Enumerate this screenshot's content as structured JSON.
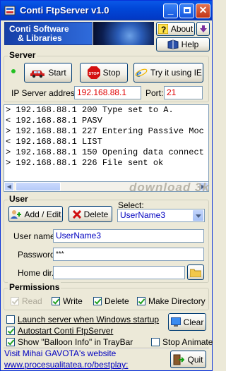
{
  "window": {
    "title": "Conti FtpServer v1.0"
  },
  "banner": {
    "line1": "Conti Software",
    "line2": "& Libraries"
  },
  "header_buttons": {
    "about": "About",
    "help": "Help"
  },
  "server": {
    "group_label": "Server",
    "start": "Start",
    "stop": "Stop",
    "try_ie": "Try it using IE",
    "ip_label": "IP Server address:",
    "ip_value": "192.168.88.1",
    "port_label": "Port:",
    "port_value": "21",
    "status_color": "#22C022"
  },
  "log": {
    "lines": [
      "> 192.168.88.1 200 Type set to A.",
      "< 192.168.88.1 PASV",
      "> 192.168.88.1 227 Entering Passive Moc",
      "< 192.168.88.1 LIST",
      "> 192.168.88.1 150 Opening data connect",
      "> 192.168.88.1 226 File sent ok"
    ]
  },
  "watermark": "download 3k",
  "user": {
    "group_label": "User",
    "add_edit": "Add / Edit",
    "delete": "Delete",
    "select_label": "Select:",
    "selected_user": "UserName3",
    "username_label": "User name:",
    "username_value": "UserName3",
    "password_label": "Password:",
    "password_value": "***",
    "home_label": "Home dir.:",
    "home_value": ""
  },
  "permissions": {
    "group_label": "Permissions",
    "items": [
      {
        "label": "Read",
        "checked": true,
        "enabled": false
      },
      {
        "label": "Write",
        "checked": true,
        "enabled": true
      },
      {
        "label": "Delete",
        "checked": true,
        "enabled": true
      },
      {
        "label": "Make Directory",
        "checked": true,
        "enabled": true
      }
    ]
  },
  "options": {
    "launch_startup": {
      "label": "Launch server when Windows startup",
      "checked": false
    },
    "autostart": {
      "label": "Autostart Conti FtpServer",
      "checked": true
    },
    "balloon": {
      "label": "Show \"Balloon Info\" in TrayBar",
      "checked": true
    },
    "stop_animate": {
      "label": "Stop Animate",
      "checked": false
    },
    "clear": "Clear"
  },
  "footer": {
    "visit_label": "Visit Mihai GAVOTA's website",
    "url": "www.procesualitatea.ro/bestplay:",
    "quit": "Quit"
  }
}
